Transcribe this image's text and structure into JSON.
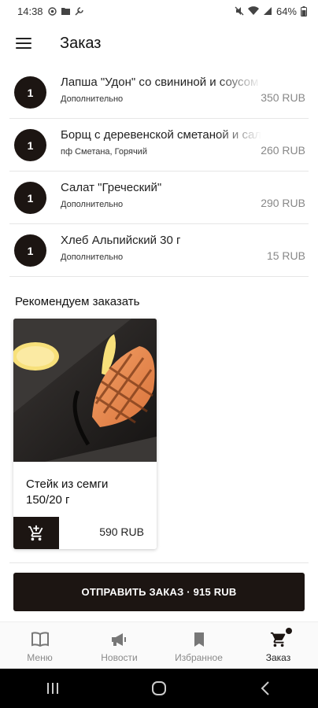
{
  "status_bar": {
    "time": "14:38",
    "battery": "64%"
  },
  "app_bar": {
    "title": "Заказ"
  },
  "order_items": [
    {
      "qty": "1",
      "name": "Лапша \"Удон\" со свининой и соусом",
      "sub": "Дополнительно",
      "price": "350 RUB"
    },
    {
      "qty": "1",
      "name": "Борщ с деревенской сметаной и салом",
      "sub": "пф Сметана, Горячий",
      "price": "260 RUB"
    },
    {
      "qty": "1",
      "name": "Салат \"Греческий\"",
      "sub": "Дополнительно",
      "price": "290 RUB"
    },
    {
      "qty": "1",
      "name": "Хлеб Альпийский 30 г",
      "sub": "Дополнительно",
      "price": "15 RUB"
    }
  ],
  "recommend": {
    "title": "Рекомендуем заказать",
    "items": [
      {
        "name": "Стейк из семги 150/20 г",
        "price": "590 RUB"
      }
    ]
  },
  "submit": {
    "label": "ОТПРАВИТЬ ЗАКАЗ · 915 RUB"
  },
  "bottom_nav": {
    "items": [
      {
        "label": "Меню",
        "icon": "book-icon",
        "active": false
      },
      {
        "label": "Новости",
        "icon": "megaphone-icon",
        "active": false
      },
      {
        "label": "Избранное",
        "icon": "bookmark-icon",
        "active": false
      },
      {
        "label": "Заказ",
        "icon": "cart-icon",
        "active": true
      }
    ]
  },
  "colors": {
    "primary": "#1c1512",
    "text": "#222222",
    "muted": "#888888",
    "divider": "#e6e6e6"
  }
}
